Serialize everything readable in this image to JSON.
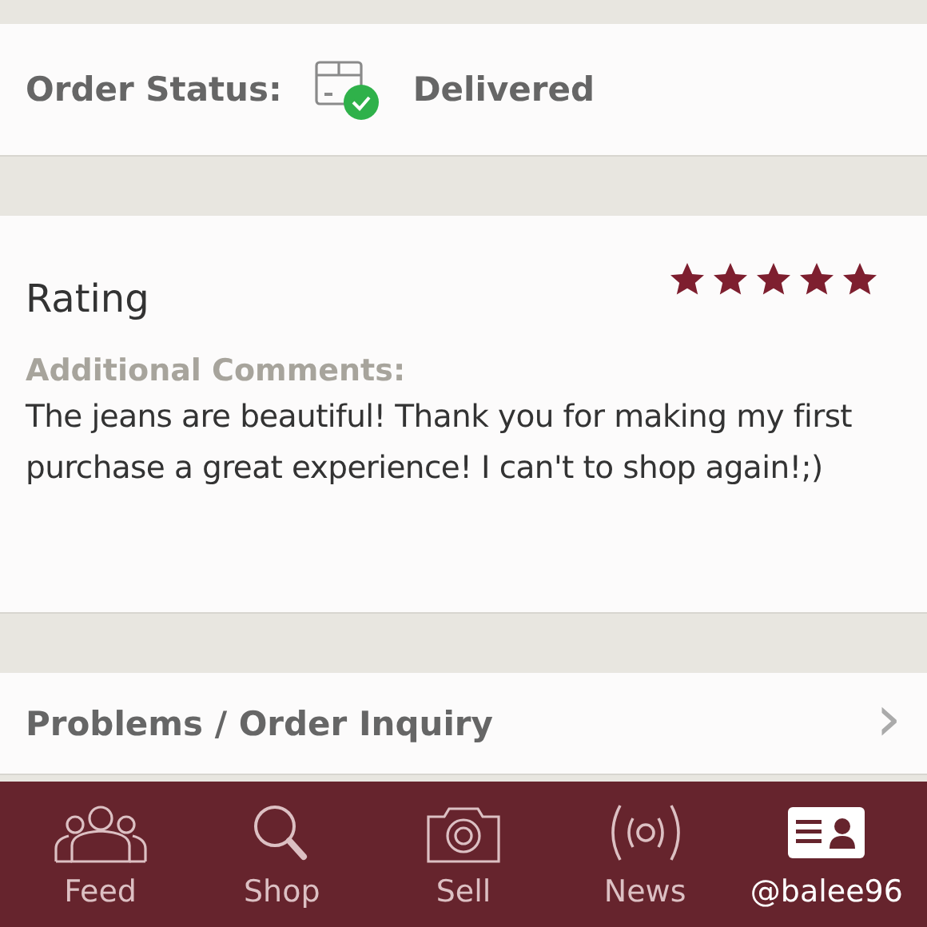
{
  "order_status": {
    "label": "Order Status:",
    "value": "Delivered"
  },
  "rating": {
    "title": "Rating",
    "stars": 5,
    "comments_label": "Additional Comments:",
    "comments": "The jeans are beautiful! Thank you for making my first purchase a great experience! I can't to shop again!;)"
  },
  "inquiry": {
    "label": "Problems / Order Inquiry",
    "arrow": "›"
  },
  "tab_bar": [
    {
      "kind": "feed",
      "label": "Feed",
      "selected": false
    },
    {
      "kind": "shop",
      "label": "Shop",
      "selected": false
    },
    {
      "kind": "sell",
      "label": "Sell",
      "selected": false
    },
    {
      "kind": "news",
      "label": "News",
      "selected": false
    },
    {
      "kind": "profile",
      "label": "@balee96",
      "selected": true
    }
  ]
}
